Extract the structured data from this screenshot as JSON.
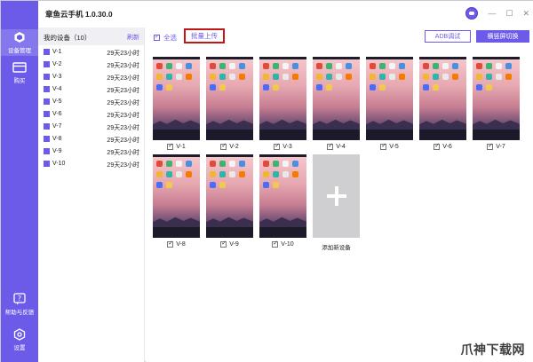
{
  "app": {
    "title": "章鱼云手机 1.0.30.0"
  },
  "window_controls": {
    "minimize": "—",
    "maximize": "☐",
    "close": "✕"
  },
  "nav": {
    "items": [
      {
        "label": "设备管理",
        "icon": "device-management-icon",
        "active": true
      },
      {
        "label": "购买",
        "icon": "purchase-icon"
      },
      {
        "label": "帮助与反馈",
        "icon": "help-icon"
      },
      {
        "label": "设置",
        "icon": "settings-icon"
      }
    ]
  },
  "device_panel": {
    "title": "我的设备（10）",
    "refresh_label": "刷新",
    "devices": [
      {
        "name": "V-1",
        "remaining": "29天23小时"
      },
      {
        "name": "V-2",
        "remaining": "29天23小时"
      },
      {
        "name": "V-3",
        "remaining": "29天23小时"
      },
      {
        "name": "V-4",
        "remaining": "29天23小时"
      },
      {
        "name": "V-5",
        "remaining": "29天23小时"
      },
      {
        "name": "V-6",
        "remaining": "29天23小时"
      },
      {
        "name": "V-7",
        "remaining": "29天23小时"
      },
      {
        "name": "V-8",
        "remaining": "29天23小时"
      },
      {
        "name": "V-9",
        "remaining": "29天23小时"
      },
      {
        "name": "V-10",
        "remaining": "29天23小时"
      }
    ]
  },
  "toolbar": {
    "select_all_label": "全选",
    "batch_upload_label": "批量上传",
    "adb_label": "ADB调试",
    "orientation_label": "横竖屏切换"
  },
  "grid": {
    "cards": [
      "V-1",
      "V-2",
      "V-3",
      "V-4",
      "V-5",
      "V-6",
      "V-7",
      "V-8",
      "V-9",
      "V-10"
    ],
    "add_label": "添加新设备"
  },
  "watermark": "爪神下载网",
  "colors": {
    "accent": "#6b5be8",
    "highlight_border": "#c01818"
  }
}
